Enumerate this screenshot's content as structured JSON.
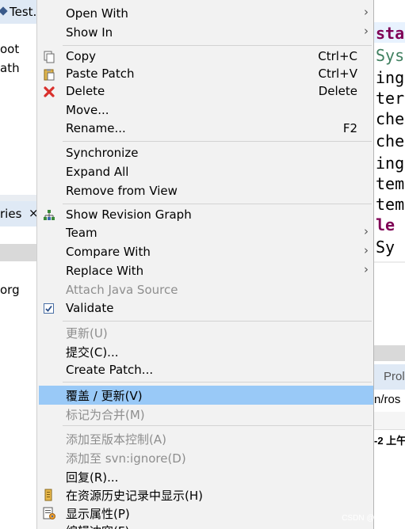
{
  "left_pane": {
    "tab_label": "Test.",
    "line1": "oot",
    "line2": "ath",
    "view_tab_label": "ries",
    "view_tab_close": "×",
    "row_text": "org"
  },
  "right_pane": {
    "code_lines": [
      "sta",
      "Sys",
      "ing",
      "ter",
      "che",
      "che",
      "ing",
      "tem",
      "tem",
      "le",
      " Sy"
    ],
    "prop_tab_label": "Prol",
    "path_text": "n/ros",
    "time_text": "-2 上午"
  },
  "menu": {
    "open_with": "Open With",
    "show_in": "Show In",
    "copy": "Copy",
    "copy_shortcut": "Ctrl+C",
    "paste_patch": "Paste Patch",
    "paste_shortcut": "Ctrl+V",
    "delete": "Delete",
    "delete_shortcut": "Delete",
    "move": "Move...",
    "rename": "Rename...",
    "rename_shortcut": "F2",
    "synchronize": "Synchronize",
    "expand_all": "Expand All",
    "remove_from_view": "Remove from View",
    "show_revision_graph": "Show Revision Graph",
    "team": "Team",
    "compare_with": "Compare With",
    "replace_with": "Replace With",
    "attach_java_source": "Attach Java Source",
    "validate": "Validate",
    "update": "更新(U)",
    "commit": "提交(C)...",
    "create_patch": "Create Patch...",
    "override_update": "覆盖 / 更新(V)",
    "mark_merged": "标记为合并(M)",
    "add_to_vc": "添加至版本控制(A)",
    "add_to_ignore": "添加至 svn:ignore(D)",
    "revert": "回复(R)...",
    "show_in_history": "在资源历史记录中显示(H)",
    "show_properties": "显示属性(P)",
    "edit_conflicts": "编辑冲突(F)"
  },
  "watermark": "CSDN @TimBL",
  "colors": {
    "menu_bg": "#f2f2f2",
    "selection": "#99c9f7",
    "disabled_text": "#8e8e8e",
    "keyword": "#7f0055",
    "comment_green": "#3f7f5f"
  }
}
